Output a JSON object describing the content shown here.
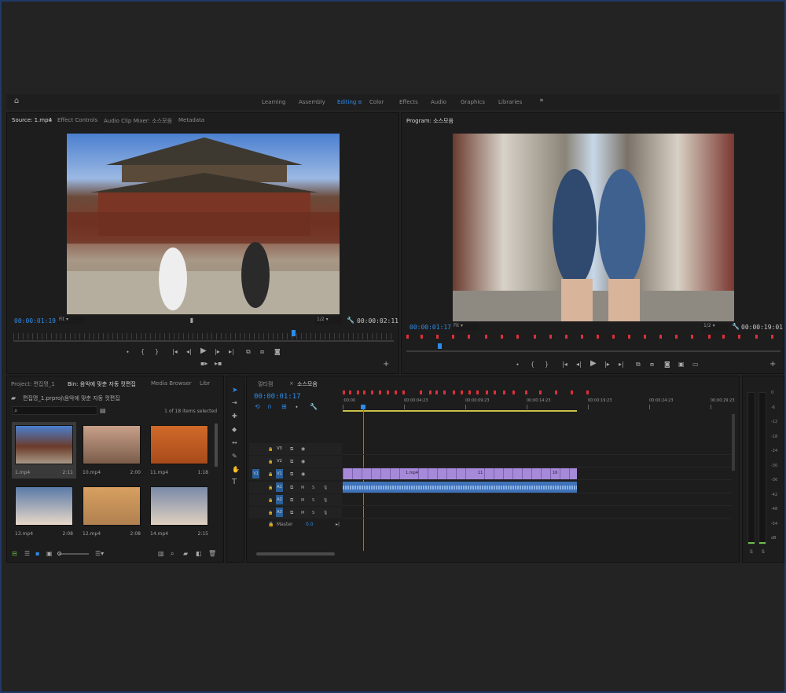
{
  "workspaces": {
    "items": [
      "Learning",
      "Assembly",
      "Editing",
      "Color",
      "Effects",
      "Audio",
      "Graphics",
      "Libraries"
    ],
    "active": "Editing"
  },
  "source": {
    "tabs": [
      "Source: 1.mp4",
      "Effect Controls",
      "Audio Clip Mixer: 소스모음",
      "Metadata"
    ],
    "timecode_in": "00:00:01:19",
    "fit": "Fit",
    "resolution": "1/2",
    "timecode_out": "00:00:02:11"
  },
  "program": {
    "tab": "Program: 소스모음",
    "timecode_in": "00:00:01:17",
    "fit": "Fit",
    "resolution": "1/2",
    "timecode_out": "00:00:19:01"
  },
  "project": {
    "tabs": [
      "Project: 편집명_1",
      "Bin: 음악에 맞춘 자동 컷편집",
      "Media Browser",
      "Libr"
    ],
    "path": "편집명_1.prproj\\음악에 맞춘 자동 컷편집",
    "items_selected": "1 of 18 items selected",
    "clips": [
      {
        "name": "1.mp4",
        "duration": "2:11"
      },
      {
        "name": "10.mp4",
        "duration": "2:00"
      },
      {
        "name": "11.mp4",
        "duration": "1:18"
      },
      {
        "name": "13.mp4",
        "duration": "2:08"
      },
      {
        "name": "12.mp4",
        "duration": "2:08"
      },
      {
        "name": "14.mp4",
        "duration": "2:15"
      }
    ]
  },
  "timeline": {
    "tabs": [
      "멀티캠",
      "소스모음"
    ],
    "timecode": "00:00:01:17",
    "ruler": [
      ":00:00",
      "00:00:04:23",
      "00:00:09:23",
      "00:00:14:23",
      "00:00:19:23",
      "00:00:24:23",
      "00:00:29:23"
    ],
    "video_tracks": [
      "V3",
      "V2",
      "V1"
    ],
    "audio_tracks": [
      "A1",
      "A2",
      "A3"
    ],
    "master": "Master",
    "master_value": "0.0",
    "clip_labels": [
      "1.mp4",
      "11",
      "16"
    ],
    "source_patch": "V1"
  },
  "meter": {
    "scale": [
      "0",
      "-6",
      "-12",
      "-18",
      "-24",
      "-30",
      "-36",
      "-42",
      "-48",
      "-54",
      "dB"
    ],
    "solo": [
      "S",
      "S"
    ]
  },
  "colors": {
    "accent": "#2d8ceb",
    "clip_video": "#a68ad9",
    "clip_audio": "#3f72b8",
    "marker": "#d9313a",
    "inout": "#c8c04a"
  }
}
